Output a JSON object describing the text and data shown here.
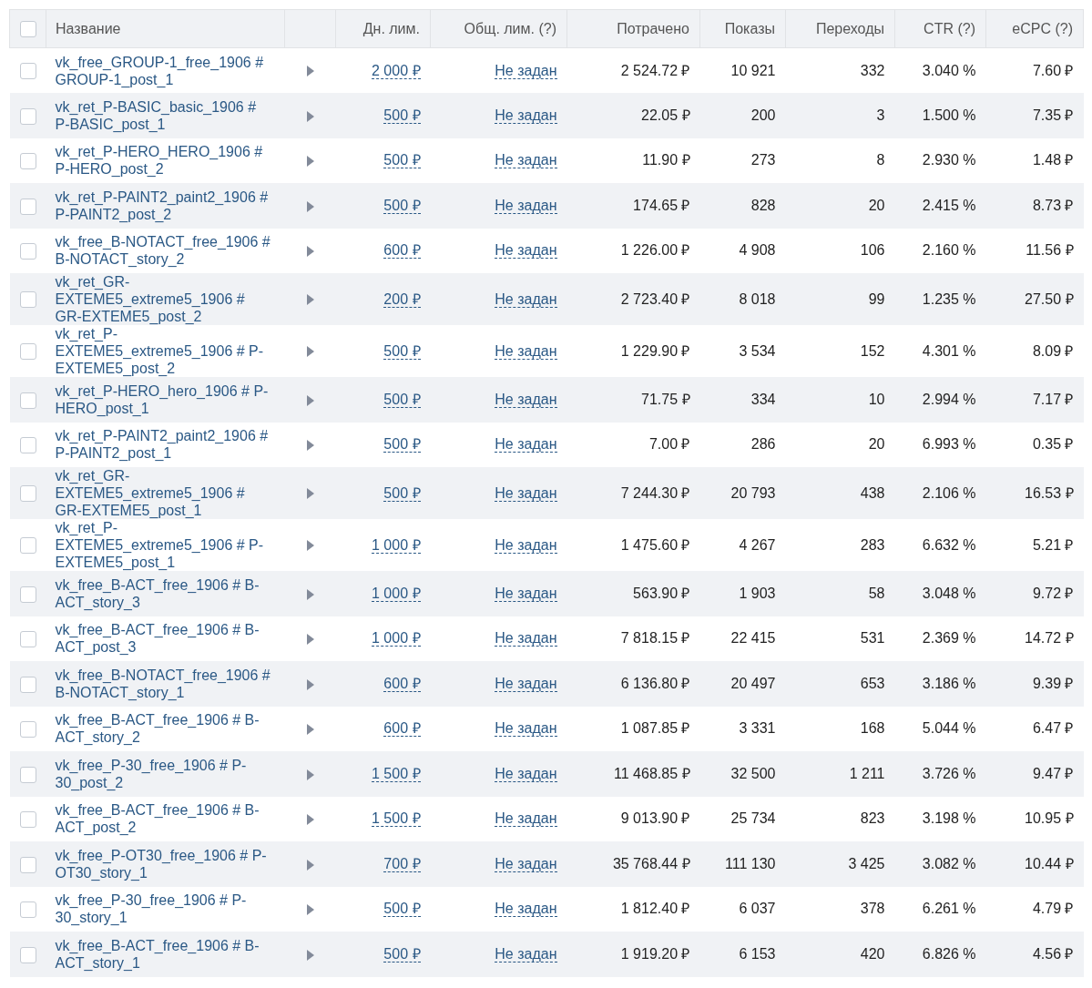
{
  "table": {
    "select_all": {
      "checked": false
    },
    "columns": [
      "Название",
      "Дн. лим.",
      "Общ. лим. (?)",
      "Потрачено",
      "Показы",
      "Переходы",
      "CTR (?)",
      "eCPC (?)"
    ],
    "rows": [
      {
        "checked": false,
        "name": "vk_free_GROUP-1_free_1906 # GROUP-1_post_1",
        "daily_limit": "2 000 ₽",
        "total_limit": "Не задан",
        "spent": "2 524.72 ₽",
        "impressions": "10 921",
        "clicks": "332",
        "ctr": "3.040 %",
        "ecpc": "7.60 ₽"
      },
      {
        "checked": false,
        "name": "vk_ret_P-BASIC_basic_1906 # P-BASIC_post_1",
        "daily_limit": "500 ₽",
        "total_limit": "Не задан",
        "spent": "22.05 ₽",
        "impressions": "200",
        "clicks": "3",
        "ctr": "1.500 %",
        "ecpc": "7.35 ₽"
      },
      {
        "checked": false,
        "name": "vk_ret_P-HERO_HERO_1906 # P-HERO_post_2",
        "daily_limit": "500 ₽",
        "total_limit": "Не задан",
        "spent": "11.90 ₽",
        "impressions": "273",
        "clicks": "8",
        "ctr": "2.930 %",
        "ecpc": "1.48 ₽"
      },
      {
        "checked": false,
        "name": "vk_ret_P-PAINT2_paint2_1906 # P-PAINT2_post_2",
        "daily_limit": "500 ₽",
        "total_limit": "Не задан",
        "spent": "174.65 ₽",
        "impressions": "828",
        "clicks": "20",
        "ctr": "2.415 %",
        "ecpc": "8.73 ₽"
      },
      {
        "checked": false,
        "name": "vk_free_B-NOTACT_free_1906 # B-NOTACT_story_2",
        "daily_limit": "600 ₽",
        "total_limit": "Не задан",
        "spent": "1 226.00 ₽",
        "impressions": "4 908",
        "clicks": "106",
        "ctr": "2.160 %",
        "ecpc": "11.56 ₽"
      },
      {
        "checked": false,
        "name": "vk_ret_GR-EXTEME5_extreme5_1906 # GR-EXTEME5_post_2",
        "daily_limit": "200 ₽",
        "total_limit": "Не задан",
        "spent": "2 723.40 ₽",
        "impressions": "8 018",
        "clicks": "99",
        "ctr": "1.235 %",
        "ecpc": "27.50 ₽"
      },
      {
        "checked": false,
        "name": "vk_ret_P-EXTEME5_extreme5_1906 # P-EXTEME5_post_2",
        "daily_limit": "500 ₽",
        "total_limit": "Не задан",
        "spent": "1 229.90 ₽",
        "impressions": "3 534",
        "clicks": "152",
        "ctr": "4.301 %",
        "ecpc": "8.09 ₽"
      },
      {
        "checked": false,
        "name": "vk_ret_P-HERO_hero_1906 # P-HERO_post_1",
        "daily_limit": "500 ₽",
        "total_limit": "Не задан",
        "spent": "71.75 ₽",
        "impressions": "334",
        "clicks": "10",
        "ctr": "2.994 %",
        "ecpc": "7.17 ₽"
      },
      {
        "checked": false,
        "name": "vk_ret_P-PAINT2_paint2_1906 # P-PAINT2_post_1",
        "daily_limit": "500 ₽",
        "total_limit": "Не задан",
        "spent": "7.00 ₽",
        "impressions": "286",
        "clicks": "20",
        "ctr": "6.993 %",
        "ecpc": "0.35 ₽"
      },
      {
        "checked": false,
        "name": "vk_ret_GR-EXTEME5_extreme5_1906 # GR-EXTEME5_post_1",
        "daily_limit": "500 ₽",
        "total_limit": "Не задан",
        "spent": "7 244.30 ₽",
        "impressions": "20 793",
        "clicks": "438",
        "ctr": "2.106 %",
        "ecpc": "16.53 ₽"
      },
      {
        "checked": false,
        "name": "vk_ret_P-EXTEME5_extreme5_1906 # P-EXTEME5_post_1",
        "daily_limit": "1 000 ₽",
        "total_limit": "Не задан",
        "spent": "1 475.60 ₽",
        "impressions": "4 267",
        "clicks": "283",
        "ctr": "6.632 %",
        "ecpc": "5.21 ₽"
      },
      {
        "checked": false,
        "name": "vk_free_B-ACT_free_1906 # B-ACT_story_3",
        "daily_limit": "1 000 ₽",
        "total_limit": "Не задан",
        "spent": "563.90 ₽",
        "impressions": "1 903",
        "clicks": "58",
        "ctr": "3.048 %",
        "ecpc": "9.72 ₽"
      },
      {
        "checked": false,
        "name": "vk_free_B-ACT_free_1906 # B-ACT_post_3",
        "daily_limit": "1 000 ₽",
        "total_limit": "Не задан",
        "spent": "7 818.15 ₽",
        "impressions": "22 415",
        "clicks": "531",
        "ctr": "2.369 %",
        "ecpc": "14.72 ₽"
      },
      {
        "checked": false,
        "name": "vk_free_B-NOTACT_free_1906 # B-NOTACT_story_1",
        "daily_limit": "600 ₽",
        "total_limit": "Не задан",
        "spent": "6 136.80 ₽",
        "impressions": "20 497",
        "clicks": "653",
        "ctr": "3.186 %",
        "ecpc": "9.39 ₽"
      },
      {
        "checked": false,
        "name": "vk_free_B-ACT_free_1906 # B-ACT_story_2",
        "daily_limit": "600 ₽",
        "total_limit": "Не задан",
        "spent": "1 087.85 ₽",
        "impressions": "3 331",
        "clicks": "168",
        "ctr": "5.044 %",
        "ecpc": "6.47 ₽"
      },
      {
        "checked": false,
        "name": "vk_free_P-30_free_1906 # P-30_post_2",
        "daily_limit": "1 500 ₽",
        "total_limit": "Не задан",
        "spent": "11 468.85 ₽",
        "impressions": "32 500",
        "clicks": "1 211",
        "ctr": "3.726 %",
        "ecpc": "9.47 ₽"
      },
      {
        "checked": false,
        "name": "vk_free_B-ACT_free_1906 # B-ACT_post_2",
        "daily_limit": "1 500 ₽",
        "total_limit": "Не задан",
        "spent": "9 013.90 ₽",
        "impressions": "25 734",
        "clicks": "823",
        "ctr": "3.198 %",
        "ecpc": "10.95 ₽"
      },
      {
        "checked": false,
        "name": "vk_free_P-OT30_free_1906 # P-OT30_story_1",
        "daily_limit": "700 ₽",
        "total_limit": "Не задан",
        "spent": "35 768.44 ₽",
        "impressions": "111 130",
        "clicks": "3 425",
        "ctr": "3.082 %",
        "ecpc": "10.44 ₽"
      },
      {
        "checked": false,
        "name": "vk_free_P-30_free_1906 # P-30_story_1",
        "daily_limit": "500 ₽",
        "total_limit": "Не задан",
        "spent": "1 812.40 ₽",
        "impressions": "6 037",
        "clicks": "378",
        "ctr": "6.261 %",
        "ecpc": "4.79 ₽"
      },
      {
        "checked": false,
        "name": "vk_free_B-ACT_free_1906 # B-ACT_story_1",
        "daily_limit": "500 ₽",
        "total_limit": "Не задан",
        "spent": "1 919.20 ₽",
        "impressions": "6 153",
        "clicks": "420",
        "ctr": "6.826 %",
        "ecpc": "4.56 ₽"
      }
    ]
  }
}
